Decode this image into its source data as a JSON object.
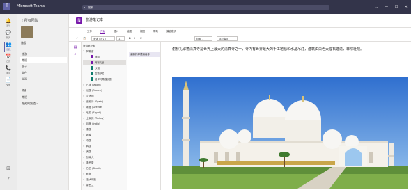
{
  "app": {
    "title": "Microsoft Teams",
    "search_placeholder": "搜索",
    "brand_color": "#6264a7",
    "window_controls": [
      "…",
      "—",
      "☐",
      "✕"
    ]
  },
  "rail": {
    "items": [
      {
        "icon": "bell-icon",
        "glyph": "🔔",
        "label": "活动"
      },
      {
        "icon": "chat-icon",
        "glyph": "💬",
        "label": "聊天"
      },
      {
        "icon": "teams-icon",
        "glyph": "👥",
        "label": "团队"
      },
      {
        "icon": "calendar-icon",
        "glyph": "📅",
        "label": "日历"
      },
      {
        "icon": "call-icon",
        "glyph": "📞",
        "label": "通话"
      },
      {
        "icon": "file-icon",
        "glyph": "📄",
        "label": "文件"
      }
    ],
    "bottom": [
      {
        "icon": "apps-icon",
        "glyph": "⊞"
      },
      {
        "icon": "help-icon",
        "glyph": "?"
      }
    ]
  },
  "team_pane": {
    "back_label": "‹ 所有团队",
    "team_name": "旅游",
    "items": [
      {
        "label": "旅游",
        "selected": false
      },
      {
        "label": "常规",
        "selected": true
      },
      {
        "label": "帖子",
        "selected": false
      },
      {
        "label": "文件",
        "selected": false
      },
      {
        "label": "Wiki",
        "selected": false
      }
    ],
    "channels_header": "频道",
    "channels": [
      "常规",
      "隐藏的频道 ›"
    ]
  },
  "page": {
    "title": "旅游笔记本",
    "ribbon_tabs": [
      "文件",
      "开始",
      "插入",
      "绘图",
      "视图",
      "帮助",
      "兼容模式"
    ],
    "active_tab": "开始",
    "toolbar": {
      "undo": "↶",
      "clipboard": "📋",
      "font": "宋体 (正文)",
      "size": "11",
      "bold": "B",
      "italic": "I",
      "underline": "U",
      "styles_label": "标题 1",
      "tag_label": "待办事项",
      "more": "···"
    }
  },
  "sections": {
    "notebook_label": "旅游笔记本",
    "items": [
      {
        "label": "阿联酋",
        "chev": "˅",
        "indent": false,
        "selected": false
      },
      {
        "label": "迪拜",
        "chev": "",
        "indent": true,
        "selected": false
      },
      {
        "label": "阿布扎比",
        "chev": "",
        "indent": true,
        "selected": true
      },
      {
        "label": "沙迦",
        "chev": "",
        "indent": true,
        "selected": false
      },
      {
        "label": "富查伊拉",
        "chev": "",
        "indent": true,
        "selected": false
      },
      {
        "label": "哈伊马角酋长国",
        "chev": "",
        "indent": true,
        "selected": false
      },
      {
        "label": "日本 (Japan)",
        "chev": "›",
        "indent": false,
        "selected": false
      },
      {
        "label": "法国 (France)",
        "chev": "›",
        "indent": false,
        "selected": false
      },
      {
        "label": "意大利",
        "chev": "›",
        "indent": false,
        "selected": false
      },
      {
        "label": "西班牙 (Spain)",
        "chev": "›",
        "indent": false,
        "selected": false
      },
      {
        "label": "希腊 (Greece)",
        "chev": "›",
        "indent": false,
        "selected": false
      },
      {
        "label": "埃及 (Egypt)",
        "chev": "›",
        "indent": false,
        "selected": false
      },
      {
        "label": "土耳其 (Turkey)",
        "chev": "›",
        "indent": false,
        "selected": false
      },
      {
        "label": "印度 (India)",
        "chev": "›",
        "indent": false,
        "selected": false
      },
      {
        "label": "泰国",
        "chev": "›",
        "indent": false,
        "selected": false
      },
      {
        "label": "越南",
        "chev": "›",
        "indent": false,
        "selected": false
      },
      {
        "label": "中国",
        "chev": "›",
        "indent": false,
        "selected": false
      },
      {
        "label": "韩国",
        "chev": "›",
        "indent": false,
        "selected": false
      },
      {
        "label": "美国",
        "chev": "›",
        "indent": false,
        "selected": false
      },
      {
        "label": "加拿大",
        "chev": "›",
        "indent": false,
        "selected": false
      },
      {
        "label": "墨西哥",
        "chev": "›",
        "indent": false,
        "selected": false
      },
      {
        "label": "巴西 (Brazil)",
        "chev": "›",
        "indent": false,
        "selected": false
      },
      {
        "label": "秘鲁",
        "chev": "›",
        "indent": false,
        "selected": false
      },
      {
        "label": "澳大利亚",
        "chev": "›",
        "indent": false,
        "selected": false
      },
      {
        "label": "新西兰",
        "chev": "›",
        "indent": false,
        "selected": false
      }
    ]
  },
  "pages": {
    "items": [
      "谢赫扎耶德清真寺"
    ]
  },
  "note": {
    "text": "谢赫扎耶德清真寺是世界上最大的清真寺之一，寺内有世界最大的手工地毯和水晶吊灯，建筑由白色大理石建造，非常壮观。",
    "image_subject": "谢赫扎耶德清真寺"
  }
}
